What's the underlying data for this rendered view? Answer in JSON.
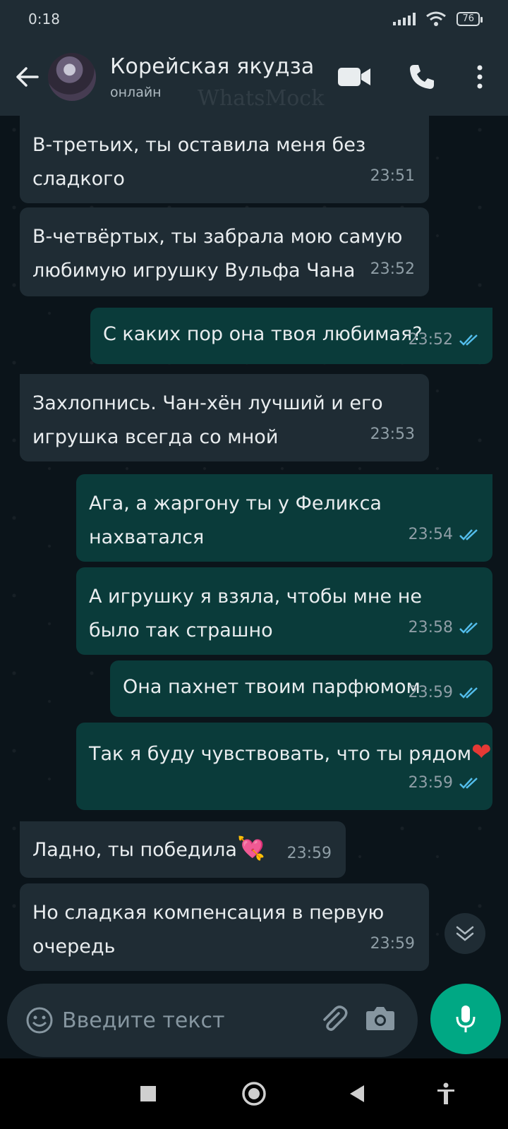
{
  "status_bar": {
    "time": "0:18",
    "battery": "76"
  },
  "header": {
    "contact_name": "Корейская якудза",
    "contact_status": "онлайн",
    "watermark": "WhatsMock",
    "icons": [
      "back-arrow-icon",
      "video-call-icon",
      "phone-icon",
      "more-vert-icon"
    ]
  },
  "messages": [
    {
      "dir": "in",
      "text": "В-третьих, ты оставила меня без сладкого",
      "time": "23:51"
    },
    {
      "dir": "in",
      "text": "В-четвёртых, ты забрала мою самую любимую игрушку Вульфа Чана",
      "time": "23:52"
    },
    {
      "dir": "out",
      "text": "С каких пор она твоя любимая?",
      "time": "23:52"
    },
    {
      "dir": "in",
      "text": "Захлопнись. Чан-хён лучший и его игрушка всегда со мной",
      "time": "23:53"
    },
    {
      "dir": "out",
      "text": "Ага, а жаргону ты у Феликса нахватался",
      "time": "23:54"
    },
    {
      "dir": "out",
      "text": "А игрушку я взяла, чтобы мне не было так страшно",
      "time": "23:58"
    },
    {
      "dir": "out",
      "text": "Она пахнет твоим парфюмом",
      "time": "23:59"
    },
    {
      "dir": "out",
      "text": "Так я буду чувствовать, что ты рядом",
      "emoji": "❤",
      "time": "23:59"
    },
    {
      "dir": "in",
      "text": "Ладно, ты победила",
      "emoji": "💘",
      "time": "23:59"
    },
    {
      "dir": "in",
      "text": "Но сладкая компенсация в первую очередь",
      "time": "23:59"
    }
  ],
  "composer": {
    "placeholder": "Введите текст"
  },
  "colors": {
    "accent": "#00a884",
    "tick_read": "#53bdeb"
  }
}
